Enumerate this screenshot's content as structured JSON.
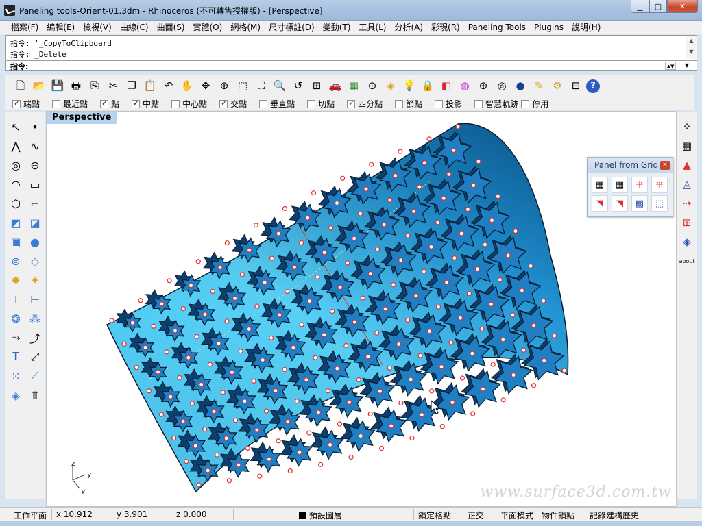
{
  "window": {
    "title": "Paneling tools-Orient-01.3dm - Rhinoceros (不可轉售授權版) - [Perspective]",
    "min_label": "▁",
    "max_label": "▢",
    "close_label": "✕"
  },
  "menu": [
    "檔案(F)",
    "編輯(E)",
    "檢視(V)",
    "曲線(C)",
    "曲面(S)",
    "實體(O)",
    "網格(M)",
    "尺寸標註(D)",
    "變動(T)",
    "工具(L)",
    "分析(A)",
    "彩現(R)",
    "Paneling Tools",
    "Plugins",
    "說明(H)"
  ],
  "command": {
    "history": [
      "指令: '_CopyToClipboard",
      "指令: _Delete"
    ],
    "prompt": "指令:"
  },
  "toolbar_icons": [
    "new-file-icon",
    "open-folder-icon",
    "save-icon",
    "print-icon",
    "export-icon",
    "cut-icon",
    "copy-icon",
    "paste-icon",
    "undo-icon",
    "pan-hand-icon",
    "rotate-view-icon",
    "zoom-dynamic-icon",
    "zoom-window-icon",
    "zoom-extents-icon",
    "zoom-selected-icon",
    "undo-view-icon",
    "four-viewports-icon",
    "car-render-icon",
    "grid-plane-icon",
    "cplane-icon",
    "layer-tools-icon",
    "light-bulb-icon",
    "lock-icon",
    "material-icon",
    "color-wheel-icon",
    "sphere-wire-icon",
    "shaded-sphere-icon",
    "render-sphere-icon",
    "render-pencil-icon",
    "settings-gear-icon",
    "options-icon",
    "help-icon"
  ],
  "osnaps": [
    {
      "label": "端點",
      "checked": true
    },
    {
      "label": "最近點",
      "checked": false
    },
    {
      "label": "點",
      "checked": true
    },
    {
      "label": "中點",
      "checked": true
    },
    {
      "label": "中心點",
      "checked": false
    },
    {
      "label": "交點",
      "checked": true
    },
    {
      "label": "垂直點",
      "checked": false
    },
    {
      "label": "切點",
      "checked": false
    },
    {
      "label": "四分點",
      "checked": true
    },
    {
      "label": "節點",
      "checked": false
    },
    {
      "label": "投影",
      "checked": false
    },
    {
      "label": "智慧軌跡",
      "checked": false
    },
    {
      "label": "停用",
      "checked": false
    }
  ],
  "viewport": {
    "label": "Perspective",
    "watermark": "www.surface3d.com.tw",
    "axes": {
      "x": "x",
      "y": "y",
      "z": "z"
    }
  },
  "panel_from_grid": {
    "title": "Panel from Grid"
  },
  "right_tools": {
    "about_label": "about"
  },
  "status": {
    "cplane": "工作平面",
    "x": "x 10.912",
    "y": "y 3.901",
    "z": "z 0.000",
    "layer": "預設圖層",
    "grid_snap": "鎖定格點",
    "ortho": "正交",
    "planar": "平面模式",
    "osnap": "物件鎖點",
    "history": "記錄建構歷史"
  },
  "colors": {
    "surface_light": "#5fd0f5",
    "surface_dark": "#0a6aa8",
    "star_fill": "#1f7fc2",
    "star_edge": "#0a1e33",
    "control_point": "#e03030"
  }
}
